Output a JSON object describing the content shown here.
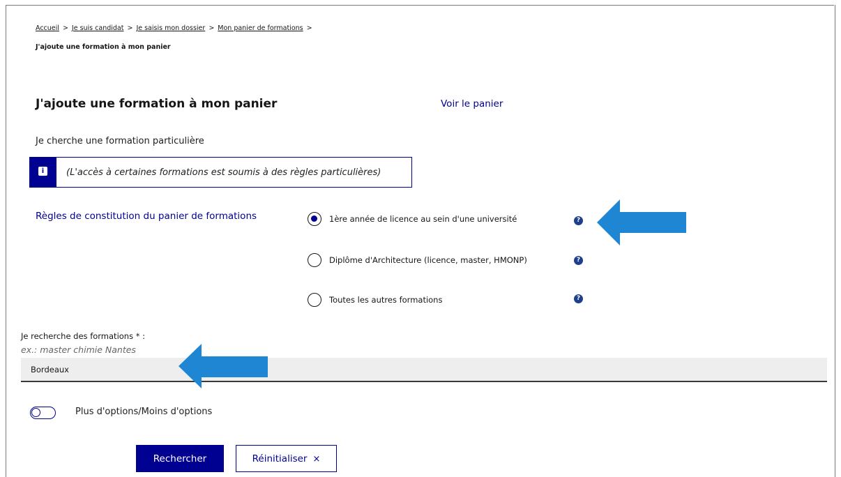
{
  "breadcrumb": {
    "items": [
      "Accueil",
      "Je suis candidat",
      "Je saisis mon dossier",
      "Mon panier de formations"
    ],
    "separator": ">",
    "current": "J'ajoute une formation à mon panier"
  },
  "header": {
    "title": "J'ajoute une formation à mon panier",
    "cart_link": "Voir le panier"
  },
  "search_section": {
    "subtitle": "Je cherche une formation particulière",
    "notice": "(L'accès à certaines formations est soumis à des règles particulières)",
    "notice_icon": "info-icon"
  },
  "rules": {
    "label": "Règles de constitution du panier de formations",
    "options": [
      {
        "label": "1ère année de licence au sein d'une université",
        "selected": true
      },
      {
        "label": "Diplôme d'Architecture (licence, master, HMONP)",
        "selected": false
      },
      {
        "label": "Toutes les autres formations",
        "selected": false
      }
    ],
    "help_icon_text": "?"
  },
  "search_field": {
    "label": "Je recherche des formations * :",
    "hint": "ex.: master chimie Nantes",
    "value": "Bordeaux"
  },
  "options_toggle": {
    "label": "Plus d'options/Moins d'options",
    "on": false
  },
  "actions": {
    "search_label": "Rechercher",
    "reset_label": "Réinitialiser",
    "reset_icon": "×"
  },
  "colors": {
    "primary": "#000091",
    "arrow": "#1f86d4",
    "input_bg": "#eeeeee",
    "help_icon": "#1f3f8c"
  }
}
